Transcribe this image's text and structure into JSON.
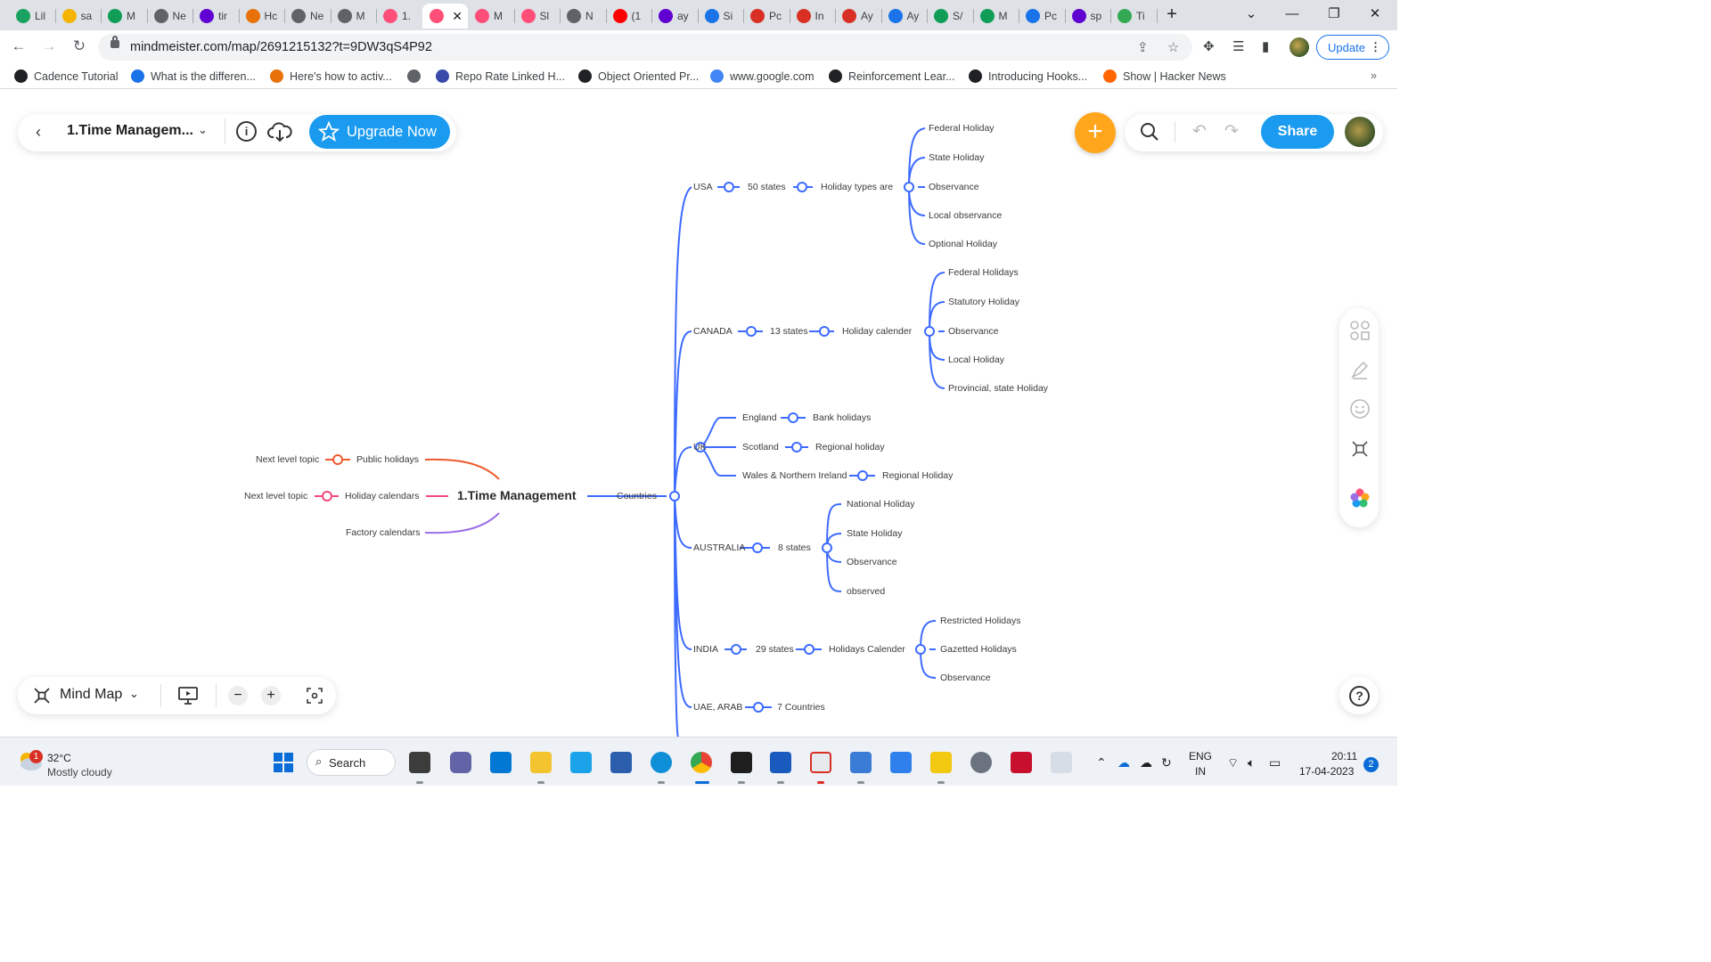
{
  "browser": {
    "tabs": [
      {
        "label": "Lil",
        "color": "#1aa260"
      },
      {
        "label": "sa",
        "color": "#f4b400"
      },
      {
        "label": "M",
        "color": "#0f9d58"
      },
      {
        "label": "Ne",
        "color": "#5f6368"
      },
      {
        "label": "tir",
        "color": "#6001d2"
      },
      {
        "label": "Hc",
        "color": "#e8710a"
      },
      {
        "label": "Ne",
        "color": "#5f6368"
      },
      {
        "label": "M",
        "color": "#5f6368"
      },
      {
        "label": "1.",
        "color": "#ff4f79"
      },
      {
        "label": "",
        "color": "#ff4f79"
      },
      {
        "label": "M",
        "color": "#ff4f79"
      },
      {
        "label": "Sl",
        "color": "#ff4f79"
      },
      {
        "label": "N",
        "color": "#5f6368"
      },
      {
        "label": "(1",
        "color": "#ff0000"
      },
      {
        "label": "ay",
        "color": "#6001d2"
      },
      {
        "label": "Si",
        "color": "#1a73e8"
      },
      {
        "label": "Pc",
        "color": "#d93025"
      },
      {
        "label": "In",
        "color": "#d93025"
      },
      {
        "label": "Ay",
        "color": "#d93025"
      },
      {
        "label": "Ay",
        "color": "#1a73e8"
      },
      {
        "label": "S/",
        "color": "#0f9d58"
      },
      {
        "label": "M",
        "color": "#0f9d58"
      },
      {
        "label": "Pc",
        "color": "#1a73e8"
      },
      {
        "label": "sp",
        "color": "#6001d2"
      },
      {
        "label": "Ti",
        "color": "#34a853"
      }
    ],
    "active_tab_close": "✕",
    "new_tab": "+",
    "url": "mindmeister.com/map/2691215132?t=9DW3qS4P92",
    "update_label": "Update",
    "bookmarks": [
      {
        "label": "Cadence Tutorial",
        "color": "#202124"
      },
      {
        "label": "What is the differen...",
        "color": "#1a73e8"
      },
      {
        "label": "Here's how to activ...",
        "color": "#e8710a"
      },
      {
        "label": "",
        "color": "#5f6368"
      },
      {
        "label": "Repo Rate Linked H...",
        "color": "#3949ab"
      },
      {
        "label": "Object Oriented Pr...",
        "color": "#202124"
      },
      {
        "label": "www.google.com",
        "color": "#4285f4"
      },
      {
        "label": "Reinforcement Lear...",
        "color": "#202124"
      },
      {
        "label": "Introducing Hooks...",
        "color": "#202124"
      },
      {
        "label": "Show | Hacker News",
        "color": "#ff6600"
      }
    ]
  },
  "app": {
    "map_title": "1.Time Managem...",
    "upgrade_label": "Upgrade Now",
    "share_label": "Share",
    "view_mode": "Mind Map",
    "root": "1.Time Management",
    "left_branches": {
      "public": "Public holidays",
      "public_child": "Next level topic",
      "calendars": "Holiday calendars",
      "calendars_child": "Next level topic",
      "factory": "Factory calendars"
    },
    "countries_label": "Countries",
    "usa": {
      "name": "USA",
      "states": "50 states",
      "types": "Holiday types are",
      "children": [
        "Federal Holiday",
        "State Holiday",
        "Observance",
        "Local observance",
        "Optional Holiday"
      ]
    },
    "canada": {
      "name": "CANADA",
      "states": "13 states",
      "calendar": "Holiday calender",
      "children": [
        "Federal Holidays",
        "Statutory Holiday",
        "Observance",
        "Local Holiday",
        "Provincial, state Holiday"
      ]
    },
    "uk": {
      "name": "UK",
      "england": "England",
      "england_child": "Bank holidays",
      "scotland": "Scotland",
      "scotland_child": "Regional holiday",
      "wales": "Wales & Northern Ireland",
      "wales_child": "Regional Holiday"
    },
    "australia": {
      "name": "AUSTRALIA",
      "states": "8 states",
      "children": [
        "National Holiday",
        "State Holiday",
        "Observance",
        "observed"
      ]
    },
    "india": {
      "name": "INDIA",
      "states": "29 states",
      "calendar": "Holidays Calender",
      "children": [
        "Restricted Holidays",
        "Gazetted Holidays",
        "Observance"
      ]
    },
    "uae": {
      "name": "UAE, ARAB",
      "countries": "7 Countries"
    }
  },
  "taskbar": {
    "temp": "32°C",
    "weather": "Mostly cloudy",
    "weather_badge": "1",
    "search_label": "Search",
    "lang1": "ENG",
    "lang2": "IN",
    "time": "20:11",
    "date": "17-04-2023",
    "notif_count": "2"
  },
  "colors": {
    "accent": "#1a9bf0",
    "branch": "#3d6bff",
    "fab": "#ffa61c",
    "public": "#ef5a2d",
    "calendars": "#f2487a",
    "factory": "#9b6fe6"
  }
}
